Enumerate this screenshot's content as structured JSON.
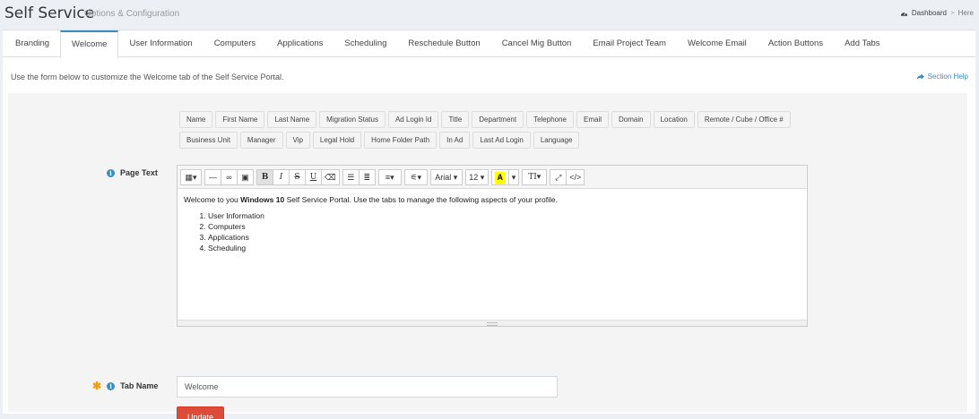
{
  "header": {
    "title": "Self Service",
    "subtitle": "Options & Configuration",
    "breadcrumb": {
      "dashboard": "Dashboard",
      "separator": ">",
      "current": "Here"
    }
  },
  "tabs": [
    {
      "label": "Branding"
    },
    {
      "label": "Welcome"
    },
    {
      "label": "User Information"
    },
    {
      "label": "Computers"
    },
    {
      "label": "Applications"
    },
    {
      "label": "Scheduling"
    },
    {
      "label": "Reschedule Button"
    },
    {
      "label": "Cancel Mig Button"
    },
    {
      "label": "Email Project Team"
    },
    {
      "label": "Welcome Email"
    },
    {
      "label": "Action Buttons"
    },
    {
      "label": "Add Tabs"
    }
  ],
  "intro": "Use the form below to customize the Welcome tab of the Self Service Portal.",
  "section_help": "Section Help",
  "tokens": [
    "Name",
    "First Name",
    "Last Name",
    "Migration Status",
    "Ad Login Id",
    "Title",
    "Department",
    "Telephone",
    "Email",
    "Domain",
    "Location",
    "Remote / Cube / Office #",
    "Business Unit",
    "Manager",
    "Vip",
    "Legal Hold",
    "Home Folder Path",
    "In Ad",
    "Last Ad Login",
    "Language"
  ],
  "page_text": {
    "label": "Page Text",
    "toolbar": {
      "font_name": "Arial",
      "font_size": "12",
      "highlight_letter": "A"
    },
    "body": {
      "prefix": "Welcome to you ",
      "bold": "Windows 10",
      "suffix": " Self Service Portal. Use the tabs to manage the following aspects of your profile.",
      "list": [
        "User Information",
        "Computers",
        "Applications",
        "Scheduling"
      ]
    }
  },
  "tab_name": {
    "label": "Tab Name",
    "value": "Welcome"
  },
  "update_button": "Update",
  "colors": {
    "accent": "#3c8dbc",
    "danger": "#dd4b39",
    "required": "#f39c12"
  },
  "icons": [
    "dashboard-icon",
    "share-icon",
    "info-icon",
    "asterisk-icon",
    "table-icon",
    "hr-icon",
    "link-icon",
    "picture-icon",
    "bold-icon",
    "italic-icon",
    "strikethrough-icon",
    "underline-icon",
    "eraser-icon",
    "unordered-list-icon",
    "ordered-list-icon",
    "align-icon",
    "magic-icon",
    "text-height-icon",
    "fullscreen-icon",
    "code-view-icon"
  ]
}
